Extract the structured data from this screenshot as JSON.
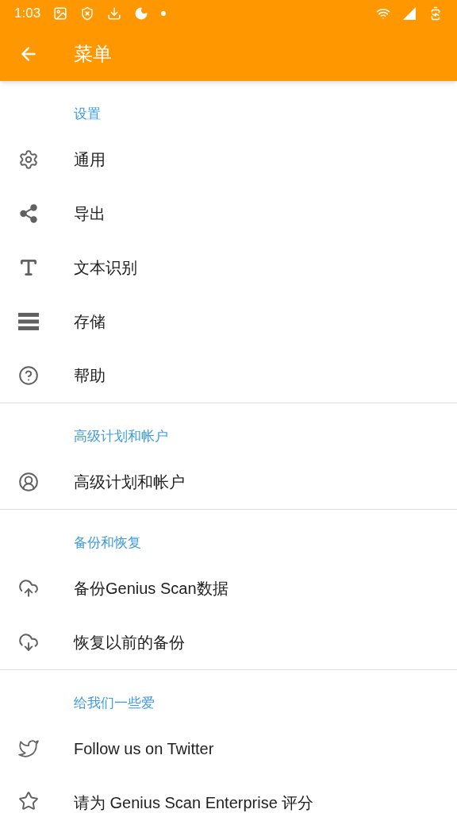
{
  "status_bar": {
    "time": "1:03"
  },
  "app_bar": {
    "title": "菜单"
  },
  "sections": [
    {
      "header": "设置",
      "items": [
        {
          "label": "通用",
          "kind": "gear"
        },
        {
          "label": "导出",
          "kind": "share"
        },
        {
          "label": "文本识别",
          "kind": "text"
        },
        {
          "label": "存储",
          "kind": "storage"
        },
        {
          "label": "帮助",
          "kind": "help"
        }
      ]
    },
    {
      "header": "高级计划和帐户",
      "items": [
        {
          "label": "高级计划和帐户",
          "kind": "account"
        }
      ]
    },
    {
      "header": "备份和恢复",
      "items": [
        {
          "label": "备份Genius Scan数据",
          "kind": "upload"
        },
        {
          "label": "恢复以前的备份",
          "kind": "download"
        }
      ]
    },
    {
      "header": "给我们一些爱",
      "items": [
        {
          "label": "Follow us on Twitter",
          "kind": "bird"
        },
        {
          "label": "请为 Genius Scan Enterprise 评分",
          "kind": "star"
        }
      ]
    }
  ]
}
